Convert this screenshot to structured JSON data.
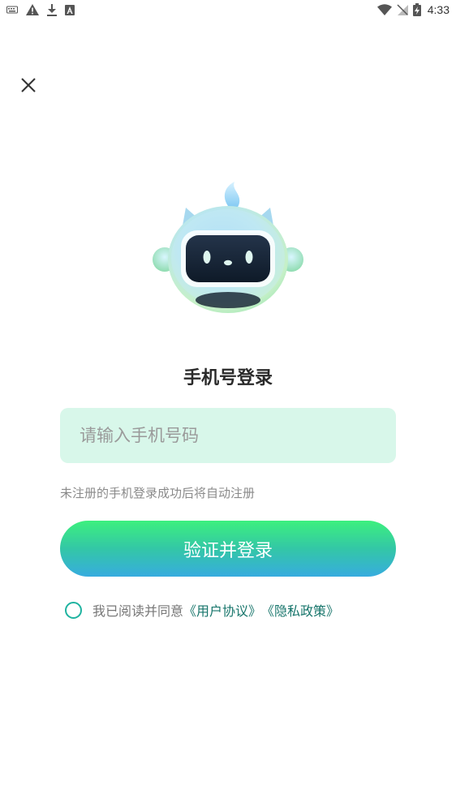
{
  "status_bar": {
    "time": "4:33",
    "left_icons": [
      "keyboard-icon",
      "warning-icon",
      "download-icon",
      "font-icon"
    ],
    "right_icons": [
      "wifi-icon",
      "no-sim-icon",
      "battery-charging-icon"
    ]
  },
  "login": {
    "title": "手机号登录",
    "phone_placeholder": "请输入手机号码",
    "hint": "未注册的手机登录成功后将自动注册",
    "submit_label": "验证并登录"
  },
  "agreement": {
    "prefix": "我已阅读并同意",
    "user_agreement": "《用户协议》",
    "privacy_policy": "《隐私政策》"
  },
  "colors": {
    "input_bg": "#d8f7ea",
    "button_gradient_top": "#3df07e",
    "button_gradient_bottom": "#37acdf",
    "link": "#17756b",
    "checkbox": "#1fb3a0"
  }
}
